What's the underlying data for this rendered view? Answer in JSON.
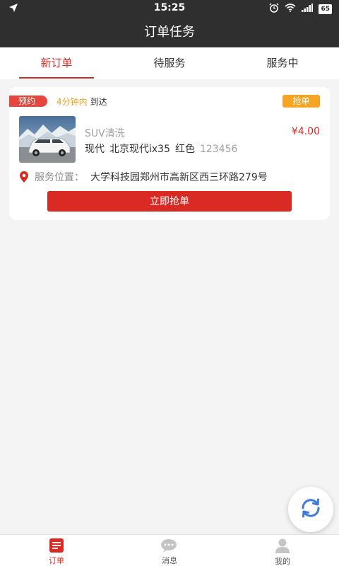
{
  "status_bar": {
    "time": "15:25",
    "battery": "65"
  },
  "header": {
    "title": "订单任务"
  },
  "tabs": [
    {
      "label": "新订单",
      "active": true
    },
    {
      "label": "待服务",
      "active": false
    },
    {
      "label": "服务中",
      "active": false
    }
  ],
  "order": {
    "badge": "预约",
    "eta_time": "4分钟内",
    "eta_text": "到达",
    "grab_badge": "抢单",
    "service_type": "SUV清洗",
    "price": "¥4.00",
    "car_brand": "现代",
    "car_model": "北京现代ix35",
    "car_color": "红色",
    "plate": "123456",
    "location_label": "服务位置：",
    "location_value": "大学科技园郑州市高新区西三环路279号",
    "grab_button": "立即抢单"
  },
  "bottom_nav": [
    {
      "label": "订单",
      "icon": "order-list-icon",
      "active": true
    },
    {
      "label": "消息",
      "icon": "message-icon",
      "active": false
    },
    {
      "label": "我的",
      "icon": "profile-icon",
      "active": false
    }
  ],
  "colors": {
    "accent": "#d92b23",
    "orange": "#f6a423",
    "header_bg": "#2f2f2f"
  }
}
